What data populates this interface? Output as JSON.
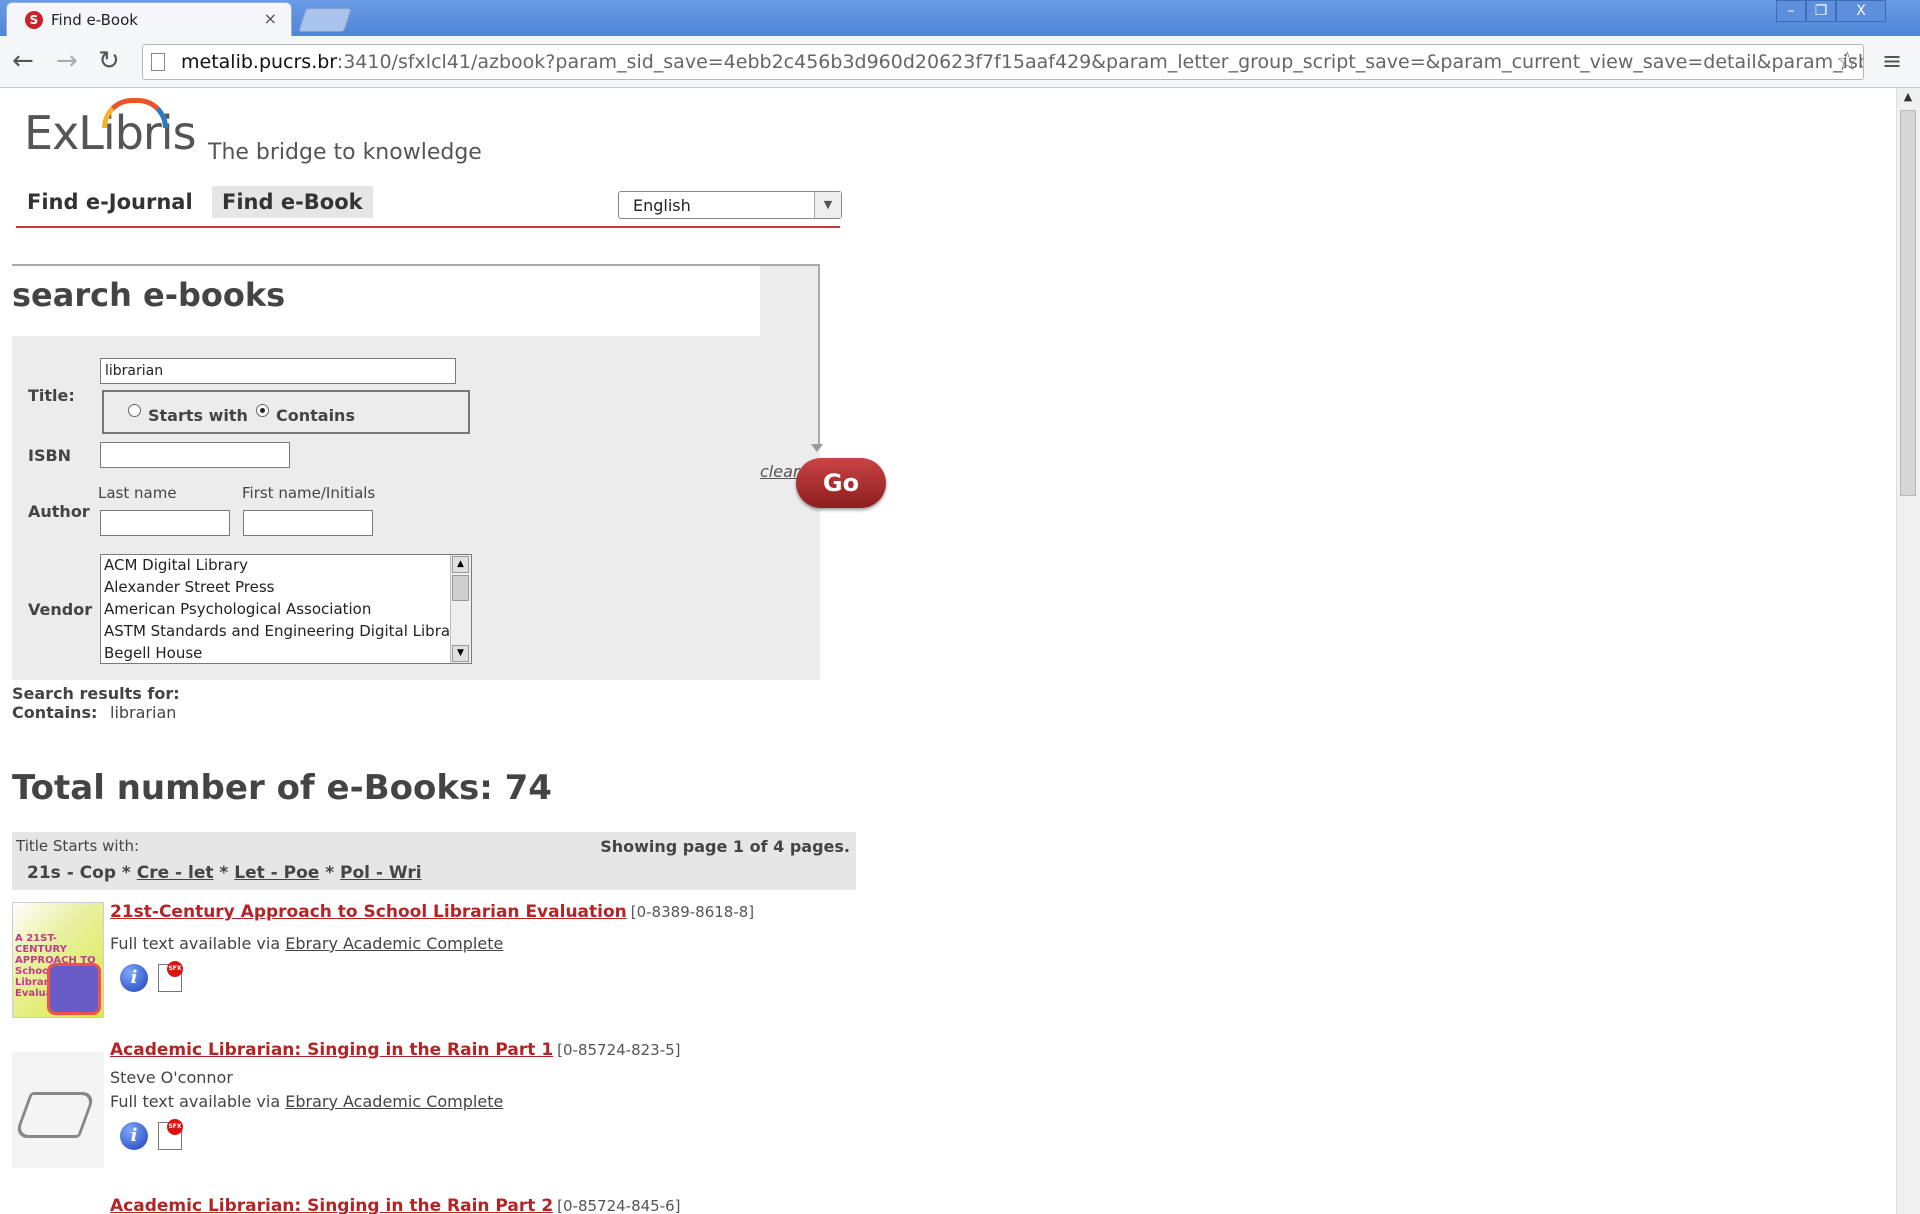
{
  "browser": {
    "tab_title": "Find e-Book",
    "favicon_glyph": "S",
    "url_host": "metalib.pucrs.br",
    "url_rest": ":3410/sfxlcl41/azbook?param_sid_save=4ebb2c456b3d960d20623f7f15aaf429&param_letter_group_script_save=&param_current_view_save=detail&param_isbn",
    "window_buttons": {
      "minimize": "–",
      "maximize": "❐",
      "close": "X"
    }
  },
  "header": {
    "logo": "ExLibris",
    "tagline": "The bridge to knowledge",
    "nav": [
      "Find e-Journal",
      "Find e-Book"
    ],
    "language": "English"
  },
  "search": {
    "heading": "search e-books",
    "title_label": "Title:",
    "title_value": "librarian",
    "radio_starts": "Starts with",
    "radio_contains": "Contains",
    "selected_mode": "Contains",
    "isbn_label": "ISBN",
    "isbn_value": "",
    "author_label": "Author",
    "last_name_label": "Last name",
    "first_name_label": "First name/Initials",
    "vendor_label": "Vendor",
    "vendors": [
      "ACM Digital Library",
      "Alexander Street Press",
      "American Psychological Association",
      "ASTM Standards and Engineering Digital Library",
      "Begell House"
    ],
    "clear_label": "clear",
    "go_label": "Go"
  },
  "results_summary": {
    "search_results_for": "Search results for:",
    "contains_label": "Contains:",
    "contains_value": "librarian",
    "total": "Total number of e-Books: 74"
  },
  "pager": {
    "label": "Title Starts with:",
    "info": "Showing page 1 of 4 pages.",
    "current_group": "21s - Cop",
    "groups": [
      "Cre - let",
      "Let - Poe",
      "Pol - Wri"
    ],
    "separator": " * "
  },
  "results": [
    {
      "title": "21st-Century Approach to School Librarian Evaluation",
      "isbn": "[0-8389-8618-8]",
      "author": "",
      "avail_prefix": "Full text available via",
      "vendor": "Ebrary Academic Complete",
      "cover_text": "A 21ST-CENTURY APPROACH TO School Librarian Evaluation"
    },
    {
      "title": "Academic Librarian: Singing in the Rain Part 1",
      "isbn": "[0-85724-823-5]",
      "author": "Steve O'connor",
      "avail_prefix": "Full text available via",
      "vendor": "Ebrary Academic Complete"
    },
    {
      "title": "Academic Librarian: Singing in the Rain Part 2",
      "isbn": "[0-85724-845-6]"
    }
  ],
  "icons": {
    "info": "i",
    "sfx": "SFX"
  }
}
